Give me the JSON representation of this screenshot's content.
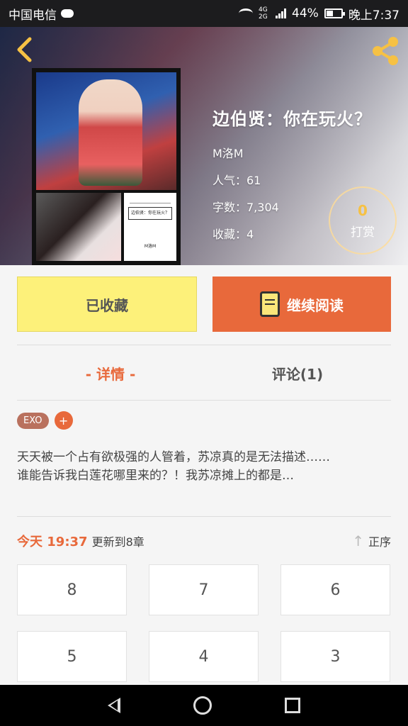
{
  "status_bar": {
    "carrier": "中国电信",
    "network": "4G 2G",
    "battery": "44%",
    "battery_level": 0.44,
    "time": "晚上7:37"
  },
  "book": {
    "title": "边伯贤：你在玩火？",
    "author": "M洛M",
    "popularity": "人气：61",
    "word_count": "字数：7,304",
    "favorites": "收藏：4",
    "cover_text": "边伯贤：你在玩火？",
    "cover_author": "M洛M"
  },
  "reward": {
    "count": "0",
    "label": "打赏"
  },
  "actions": {
    "favorite_label": "已收藏",
    "read_label": "继续阅读"
  },
  "tabs": [
    {
      "label": "- 详情 -",
      "active": true
    },
    {
      "label": "评论(1)",
      "active": false
    }
  ],
  "tags": [
    "EXO"
  ],
  "tag_add_label": "+",
  "description": {
    "line1": "天天被一个占有欲极强的人管着，苏凉真的是无法描述……",
    "line2": "谁能告诉我白莲花哪里来的？！我苏凉摊上的都是…"
  },
  "update": {
    "date": "今天 19:37",
    "text": "更新到8章",
    "order_label": "正序"
  },
  "chapters": [
    "8",
    "7",
    "6",
    "5",
    "4",
    "3"
  ],
  "colors": {
    "accent": "#e8693b",
    "favorite_bg": "#fdf17a",
    "reward_gold": "#f6c144"
  },
  "icons": {
    "back": "chevron-left-icon",
    "share": "share-icon",
    "read": "book-icon",
    "order": "up-arrow-icon"
  }
}
